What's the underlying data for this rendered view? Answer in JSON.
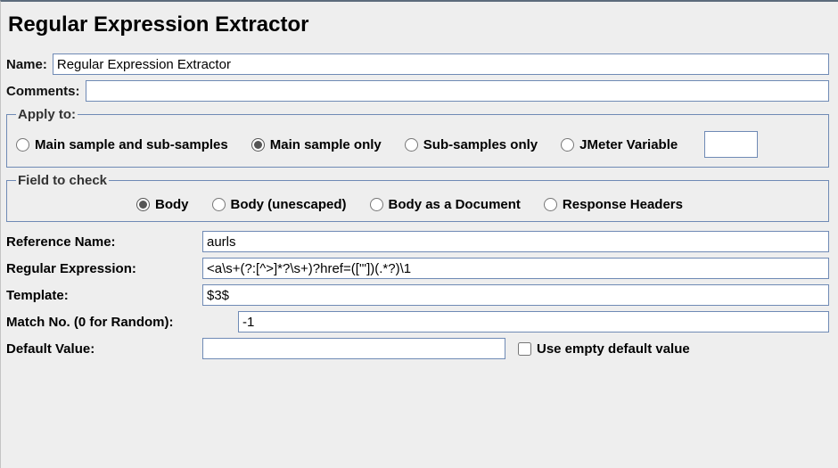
{
  "page_title": "Regular Expression Extractor",
  "name_row": {
    "label": "Name:",
    "value": "Regular Expression Extractor"
  },
  "comments_row": {
    "label": "Comments:",
    "value": ""
  },
  "apply_to": {
    "legend": "Apply to:",
    "options": [
      {
        "label": "Main sample and sub-samples",
        "checked": false
      },
      {
        "label": "Main sample only",
        "checked": true
      },
      {
        "label": "Sub-samples only",
        "checked": false
      },
      {
        "label": "JMeter Variable",
        "checked": false
      }
    ],
    "jmeter_variable_value": ""
  },
  "field_to_check": {
    "legend": "Field to check",
    "options": [
      {
        "label": "Body",
        "checked": true
      },
      {
        "label": "Body (unescaped)",
        "checked": false
      },
      {
        "label": "Body as a Document",
        "checked": false
      },
      {
        "label": "Response Headers",
        "checked": false
      }
    ]
  },
  "form": {
    "reference_name": {
      "label": "Reference Name:",
      "value": "aurls"
    },
    "regular_expression": {
      "label": "Regular Expression:",
      "value": "<a\\s+(?:[^>]*?\\s+)?href=(['\"])(.*?)\\1"
    },
    "template": {
      "label": "Template:",
      "value": "$3$"
    },
    "match_no": {
      "label": "Match No. (0 for Random):",
      "value": "-1"
    },
    "default_value": {
      "label": "Default Value:",
      "value": ""
    },
    "use_empty_default": {
      "label": "Use empty default value",
      "checked": false
    }
  }
}
